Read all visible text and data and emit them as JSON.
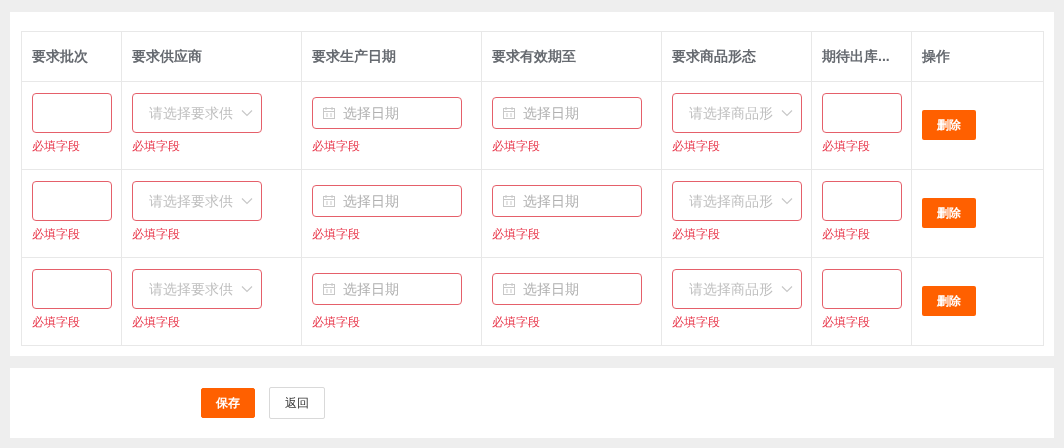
{
  "table": {
    "columns": [
      "要求批次",
      "要求供应商",
      "要求生产日期",
      "要求有效期至",
      "要求商品形态",
      "期待出库...",
      "操作"
    ],
    "rows": [
      {
        "cells": [
          {
            "kind": "text",
            "error": "必填字段"
          },
          {
            "kind": "select",
            "placeholder": "请选择要求供",
            "error": "必填字段"
          },
          {
            "kind": "date",
            "placeholder": "选择日期",
            "error": "必填字段"
          },
          {
            "kind": "date",
            "placeholder": "选择日期",
            "error": "必填字段"
          },
          {
            "kind": "select",
            "placeholder": "请选择商品形",
            "error": "必填字段"
          },
          {
            "kind": "text",
            "error": "必填字段"
          },
          {
            "kind": "action",
            "label": "删除"
          }
        ]
      },
      {
        "cells": [
          {
            "kind": "text",
            "error": "必填字段"
          },
          {
            "kind": "select",
            "placeholder": "请选择要求供",
            "error": "必填字段"
          },
          {
            "kind": "date",
            "placeholder": "选择日期",
            "error": "必填字段"
          },
          {
            "kind": "date",
            "placeholder": "选择日期",
            "error": "必填字段"
          },
          {
            "kind": "select",
            "placeholder": "请选择商品形",
            "error": "必填字段"
          },
          {
            "kind": "text",
            "error": "必填字段"
          },
          {
            "kind": "action",
            "label": "删除"
          }
        ]
      },
      {
        "cells": [
          {
            "kind": "text",
            "error": "必填字段"
          },
          {
            "kind": "select",
            "placeholder": "请选择要求供",
            "error": "必填字段"
          },
          {
            "kind": "date",
            "placeholder": "选择日期",
            "error": "必填字段"
          },
          {
            "kind": "date",
            "placeholder": "选择日期",
            "error": "必填字段"
          },
          {
            "kind": "select",
            "placeholder": "请选择商品形",
            "error": "必填字段"
          },
          {
            "kind": "text",
            "error": "必填字段"
          },
          {
            "kind": "action",
            "label": "删除"
          }
        ]
      }
    ]
  },
  "footer": {
    "buttons": [
      {
        "label": "保存",
        "kind": "primary"
      },
      {
        "label": "返回",
        "kind": "default"
      }
    ]
  }
}
